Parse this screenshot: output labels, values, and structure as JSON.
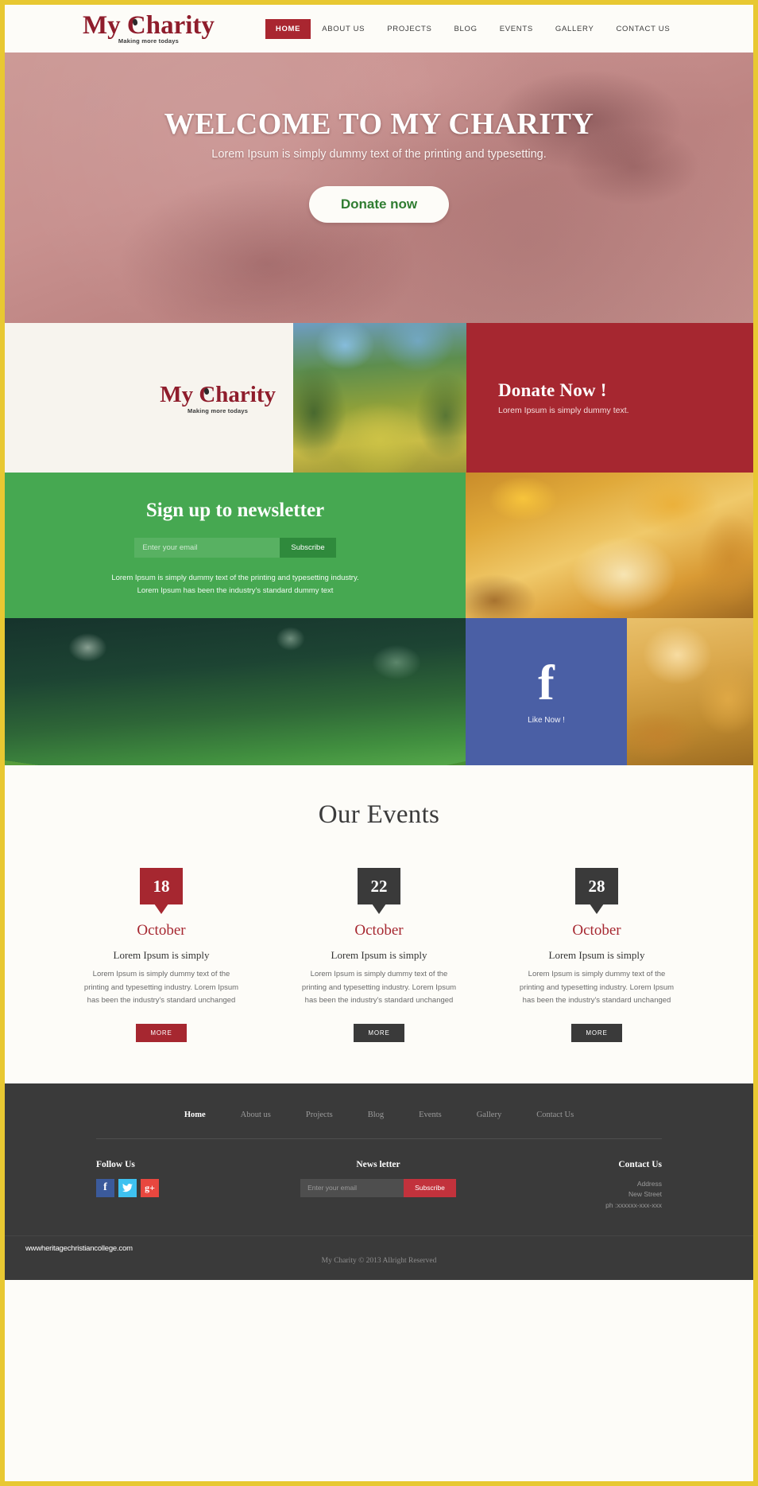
{
  "brand": {
    "name_part1": "My ",
    "name_part2": "Charity",
    "tagline": "Making more todays",
    "accent_red": "#a62730",
    "accent_green": "#46a851",
    "accent_yellow": "#e8c832",
    "facebook_blue": "#4a5fa5"
  },
  "nav": {
    "items": [
      {
        "label": "HOME",
        "active": true
      },
      {
        "label": "ABOUT US",
        "active": false
      },
      {
        "label": "PROJECTS",
        "active": false
      },
      {
        "label": "BLOG",
        "active": false
      },
      {
        "label": "EVENTS",
        "active": false
      },
      {
        "label": "GALLERY",
        "active": false
      },
      {
        "label": "CONTACT US",
        "active": false
      }
    ]
  },
  "hero": {
    "title": "WELCOME TO MY CHARITY",
    "subtitle": "Lorem Ipsum is simply dummy text of the printing and typesetting.",
    "button_label": "Donate now"
  },
  "band_donate": {
    "title": "Donate Now !",
    "subtitle": "Lorem Ipsum is simply dummy text."
  },
  "newsletter": {
    "title": "Sign up to newsletter",
    "placeholder": "Enter your email",
    "button_label": "Subscribe",
    "blurb": "Lorem Ipsum is simply dummy text of the printing and typesetting industry. Lorem Ipsum has been the industry's standard dummy text"
  },
  "facebook": {
    "glyph": "f",
    "label": "Like Now !"
  },
  "events": {
    "heading": "Our Events",
    "cards": [
      {
        "day": "18",
        "month": "October",
        "title": "Lorem Ipsum is simply",
        "body": "Lorem Ipsum is simply dummy text of the printing and typesetting industry. Lorem Ipsum has been the industry's standard unchanged",
        "more_label": "MORE",
        "style": "red"
      },
      {
        "day": "22",
        "month": "October",
        "title": "Lorem Ipsum is simply",
        "body": "Lorem Ipsum is simply dummy text of the printing and typesetting industry. Lorem Ipsum has been the industry's standard unchanged",
        "more_label": "MORE",
        "style": "dark"
      },
      {
        "day": "28",
        "month": "October",
        "title": "Lorem Ipsum is simply",
        "body": "Lorem Ipsum is simply dummy text of the printing and typesetting industry. Lorem Ipsum has been the industry's standard unchanged",
        "more_label": "MORE",
        "style": "dark"
      }
    ]
  },
  "footer": {
    "nav": [
      {
        "label": "Home",
        "active": true
      },
      {
        "label": "About us",
        "active": false
      },
      {
        "label": "Projects",
        "active": false
      },
      {
        "label": "Blog",
        "active": false
      },
      {
        "label": "Events",
        "active": false
      },
      {
        "label": "Gallery",
        "active": false
      },
      {
        "label": "Contact Us",
        "active": false
      }
    ],
    "follow": {
      "heading": "Follow Us",
      "socials": [
        {
          "icon": "facebook-icon",
          "glyph": "f",
          "color": "#3b5a9b"
        },
        {
          "icon": "twitter-icon",
          "glyph": "🐦",
          "color": "#3ec1f0"
        },
        {
          "icon": "google-plus-icon",
          "glyph": "g+",
          "color": "#e8473f"
        }
      ]
    },
    "newsletter": {
      "heading": "News letter",
      "placeholder": "Enter your email",
      "button_label": "Subscribe"
    },
    "contact": {
      "heading": "Contact Us",
      "line1": "Address",
      "line2": "New Street",
      "line3": "ph :xxxxxx-xxx-xxx"
    },
    "watermark": "wwwheritagechristiancollege.com",
    "copyright": "My Charity © 2013 Allright Reserved"
  }
}
